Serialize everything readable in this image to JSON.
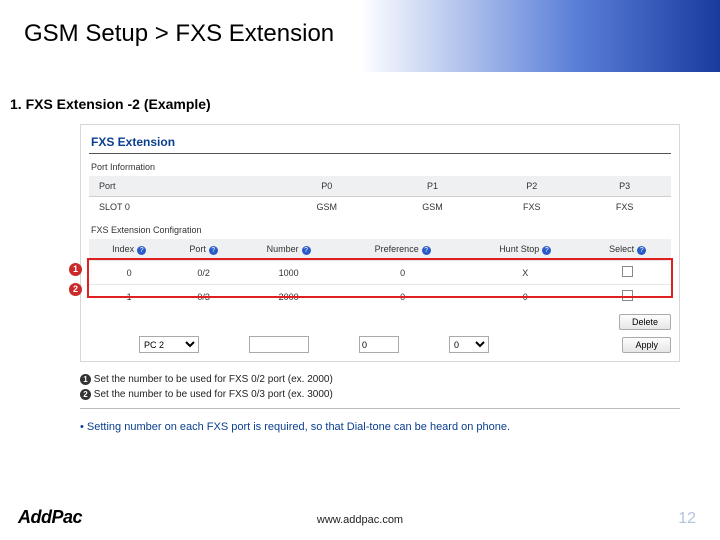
{
  "header": {
    "title": "GSM Setup > FXS Extension"
  },
  "section": {
    "title": "1. FXS Extension -2 (Example)"
  },
  "panel": {
    "heading": "FXS Extension",
    "port_info_label": "Port Information",
    "port_table": {
      "headers": [
        "P0",
        "P1",
        "P2",
        "P3"
      ],
      "row_label": "SLOT 0",
      "cells": [
        "GSM",
        "GSM",
        "FXS",
        "FXS"
      ]
    },
    "config_label": "FXS Extension Configration",
    "cfg_headers": [
      "Index",
      "Port",
      "Number",
      "Preference",
      "Hunt Stop",
      "Select"
    ],
    "cfg_rows": [
      {
        "ann": "1",
        "index": "0",
        "port": "0/2",
        "number": "1000",
        "pref": "0",
        "hunt": "X",
        "select": ""
      },
      {
        "ann": "2",
        "index": "1",
        "port": "0/3",
        "number": "2000",
        "pref": "0",
        "hunt": "0",
        "select": ""
      }
    ],
    "delete_btn": "Delete",
    "add_row": {
      "pc_option": "PC 2",
      "pref_default": "0",
      "pref_sel": "0",
      "apply_btn": "Apply"
    }
  },
  "notes": {
    "l1": "Set the number to be used for FXS 0/2 port (ex. 2000)",
    "l2": "Set the number to be used for FXS 0/3 port (ex. 3000)",
    "bullet": "Setting number on each FXS port is required, so that Dial-tone can be heard on phone."
  },
  "footer": {
    "logo": "AddPac",
    "url": "www.addpac.com",
    "page": "12"
  },
  "marks": {
    "q": "?",
    "n1": "1",
    "n2": "2"
  }
}
